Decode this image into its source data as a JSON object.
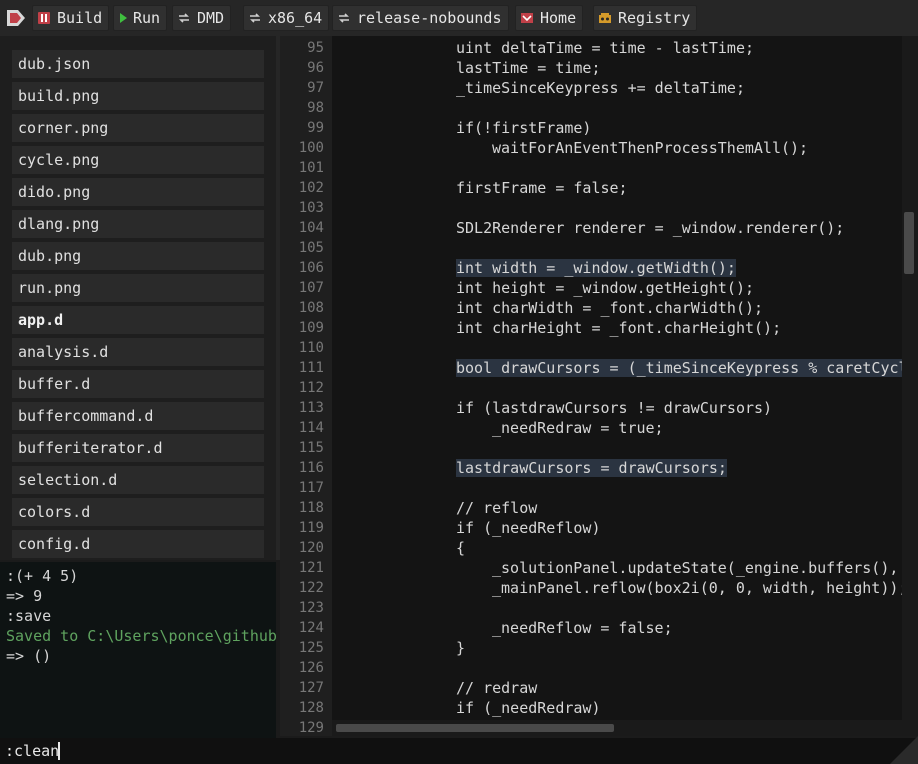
{
  "toolbar": {
    "buttons": [
      {
        "label": "Build",
        "icon": "build-icon"
      },
      {
        "label": "Run",
        "icon": "play-icon"
      },
      {
        "label": "DMD",
        "icon": "cycle-icon"
      },
      {
        "label": "x86_64",
        "icon": "cycle-icon"
      },
      {
        "label": "release-nobounds",
        "icon": "cycle-icon"
      },
      {
        "label": "Home",
        "icon": "home-icon"
      },
      {
        "label": "Registry",
        "icon": "dub-icon"
      }
    ]
  },
  "files": [
    {
      "name": "dub.json"
    },
    {
      "name": "build.png"
    },
    {
      "name": "corner.png"
    },
    {
      "name": "cycle.png"
    },
    {
      "name": "dido.png"
    },
    {
      "name": "dlang.png"
    },
    {
      "name": "dub.png"
    },
    {
      "name": "run.png"
    },
    {
      "name": "app.d"
    },
    {
      "name": "analysis.d"
    },
    {
      "name": "buffer.d"
    },
    {
      "name": "buffercommand.d"
    },
    {
      "name": "bufferiterator.d"
    },
    {
      "name": "selection.d"
    },
    {
      "name": "colors.d"
    },
    {
      "name": "config.d"
    }
  ],
  "console": [
    ":(+ 4 5)",
    "=> 9",
    ":save",
    "Saved to C:\\Users\\ponce\\github",
    "=> ()"
  ],
  "editor": {
    "line_numbers": [
      "95",
      "96",
      "97",
      "98",
      "99",
      "100",
      "101",
      "102",
      "103",
      "104",
      "105",
      "106",
      "107",
      "108",
      "109",
      "110",
      "111",
      "112",
      "113",
      "114",
      "115",
      "116",
      "117",
      "118",
      "119",
      "120",
      "121",
      "122",
      "123",
      "124",
      "125",
      "126",
      "127",
      "128",
      "129"
    ],
    "lines": [
      "    uint deltaTime = time - lastTime;",
      "    lastTime = time;",
      "    _timeSinceKeypress += deltaTime;",
      "",
      "    if(!firstFrame)",
      "        waitForAnEventThenProcessThemAll();",
      "",
      "    firstFrame = false;",
      "",
      "    SDL2Renderer renderer = _window.renderer();",
      "",
      "    int width = _window.getWidth();",
      "    int height = _window.getHeight();",
      "    int charWidth = _font.charWidth();",
      "    int charHeight = _font.charHeight();",
      "",
      "    bool drawCursors = (_timeSinceKeypress % caretCycl",
      "",
      "    if (lastdrawCursors != drawCursors)",
      "        _needRedraw = true;",
      "",
      "    lastdrawCursors = drawCursors;",
      "",
      "    // reflow",
      "    if (_needReflow)",
      "    {",
      "        _solutionPanel.updateState(_engine.buffers(),",
      "        _mainPanel.reflow(box2i(0, 0, width, height));",
      "",
      "        _needReflow = false;",
      "    }",
      "",
      "    // redraw",
      "    if (_needRedraw)",
      ""
    ]
  },
  "command_line": {
    "text": ":clean"
  },
  "colors": {
    "accent": "#c04048",
    "run_green": "#3fbf3f",
    "highlight": "#2b3441",
    "console_ok": "#5fa35f"
  }
}
